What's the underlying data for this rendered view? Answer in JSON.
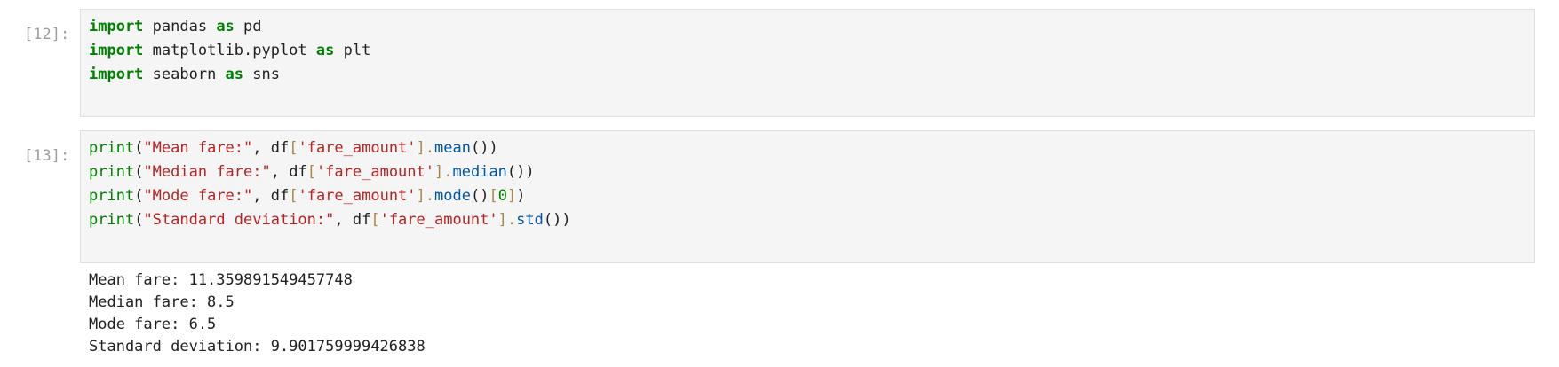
{
  "cells": [
    {
      "prompt": "[12]:",
      "code": [
        [
          "import",
          " pandas ",
          "as",
          " pd"
        ],
        [
          "import",
          " matplotlib.pyplot ",
          "as",
          " plt"
        ],
        [
          "import",
          " seaborn ",
          "as",
          " sns"
        ]
      ]
    },
    {
      "prompt": "[13]:",
      "code": [
        {
          "fn": "print",
          "p1": "(",
          "str": "\"Mean fare:\"",
          "p2": ", df",
          "b1": "[",
          "key": "'fare_amount'",
          "b2": "]",
          "dot": ".",
          "meth": "mean",
          "tail": "())",
          "idx": ""
        },
        {
          "fn": "print",
          "p1": "(",
          "str": "\"Median fare:\"",
          "p2": ", df",
          "b1": "[",
          "key": "'fare_amount'",
          "b2": "]",
          "dot": ".",
          "meth": "median",
          "tail": "())",
          "idx": ""
        },
        {
          "fn": "print",
          "p1": "(",
          "str": "\"Mode fare:\"",
          "p2": ", df",
          "b1": "[",
          "key": "'fare_amount'",
          "b2": "]",
          "dot": ".",
          "meth": "mode",
          "tail": "()",
          "idx": "0"
        },
        {
          "fn": "print",
          "p1": "(",
          "str": "\"Standard deviation:\"",
          "p2": ", df",
          "b1": "[",
          "key": "'fare_amount'",
          "b2": "]",
          "dot": ".",
          "meth": "std",
          "tail": "())",
          "idx": ""
        }
      ],
      "output": [
        "Mean fare: 11.359891549457748",
        "Median fare: 8.5",
        "Mode fare: 6.5",
        "Standard deviation: 9.901759999426838"
      ]
    }
  ]
}
